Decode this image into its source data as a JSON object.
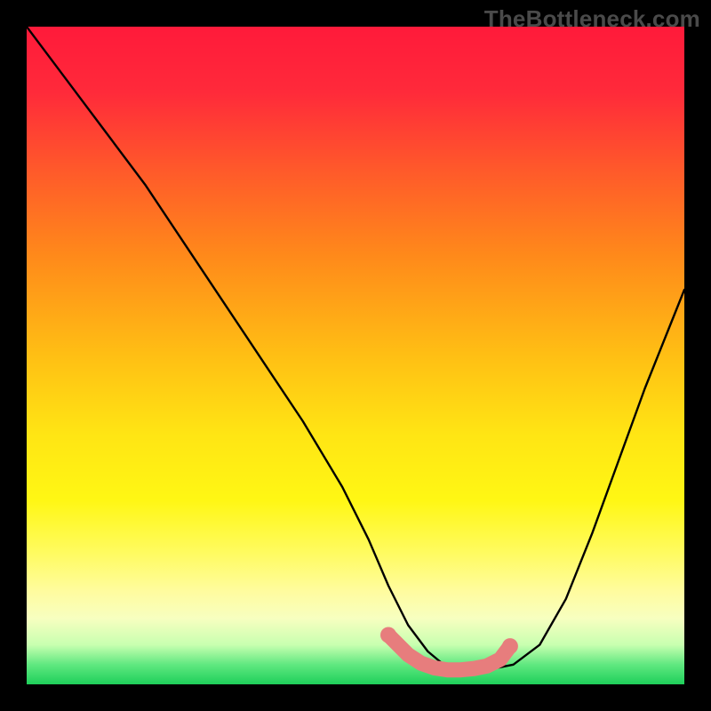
{
  "watermark": "TheBottleneck.com",
  "chart_data": {
    "type": "line",
    "title": "",
    "xlabel": "",
    "ylabel": "",
    "xlim": [
      0,
      100
    ],
    "ylim": [
      0,
      100
    ],
    "series": [
      {
        "name": "curve",
        "x": [
          0,
          6,
          12,
          18,
          24,
          30,
          36,
          42,
          48,
          52,
          55,
          58,
          61,
          64,
          67,
          70,
          74,
          78,
          82,
          86,
          90,
          94,
          98,
          100
        ],
        "y": [
          100,
          92,
          84,
          76,
          67,
          58,
          49,
          40,
          30,
          22,
          15,
          9,
          5,
          2.5,
          2,
          2.2,
          3,
          6,
          13,
          23,
          34,
          45,
          55,
          60
        ]
      },
      {
        "name": "highlight-band",
        "x": [
          55,
          58,
          60,
          62,
          64,
          66,
          68,
          70,
          72,
          73.5
        ],
        "y": [
          7.5,
          4.5,
          3.2,
          2.5,
          2.2,
          2.2,
          2.4,
          2.8,
          3.8,
          5.8
        ]
      }
    ],
    "colors": {
      "curve": "#000000",
      "highlight": "#e77d7d",
      "gradient_top": "#ff1a3a",
      "gradient_mid": "#ffe514",
      "gradient_bottom": "#1ecf5a"
    }
  }
}
